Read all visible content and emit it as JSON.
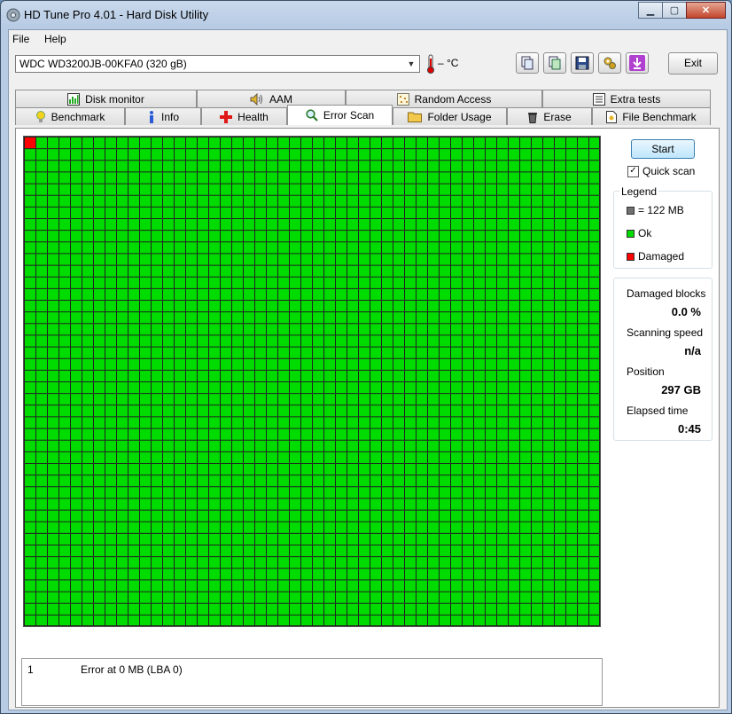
{
  "window": {
    "title": "HD Tune Pro 4.01 - Hard Disk Utility"
  },
  "menu": [
    "File",
    "Help"
  ],
  "toolbar": {
    "drive": "WDC WD3200JB-00KFA0 (320 gB)",
    "temperature": "– °C",
    "exit_label": "Exit"
  },
  "tabs_top": [
    {
      "label": "Disk monitor",
      "icon": "chart-icon"
    },
    {
      "label": "AAM",
      "icon": "speaker-icon"
    },
    {
      "label": "Random Access",
      "icon": "dots-icon"
    },
    {
      "label": "Extra tests",
      "icon": "list-icon"
    }
  ],
  "tabs_bottom": [
    {
      "label": "Benchmark",
      "icon": "bulb-icon"
    },
    {
      "label": "Info",
      "icon": "info-icon"
    },
    {
      "label": "Health",
      "icon": "cross-icon"
    },
    {
      "label": "Error Scan",
      "icon": "magnifier-icon",
      "active": true
    },
    {
      "label": "Folder Usage",
      "icon": "folder-icon"
    },
    {
      "label": "Erase",
      "icon": "trash-icon"
    },
    {
      "label": "File Benchmark",
      "icon": "file-icon"
    }
  ],
  "scan": {
    "start_label": "Start",
    "quick_scan_label": "Quick scan",
    "quick_scan_checked": true
  },
  "legend": {
    "title": "Legend",
    "block_size": "= 122 MB",
    "ok": "Ok",
    "damaged": "Damaged"
  },
  "stats": {
    "damaged_blocks_label": "Damaged blocks",
    "damaged_blocks": "0.0 %",
    "scanning_speed_label": "Scanning speed",
    "scanning_speed": "n/a",
    "position_label": "Position",
    "position": "297 GB",
    "elapsed_label": "Elapsed time",
    "elapsed": "0:45"
  },
  "log": [
    {
      "index": "1",
      "message": "Error at 0 MB (LBA 0)"
    }
  ],
  "colors": {
    "ok": "#00dc00",
    "damaged": "#ff0000",
    "block": "#707070",
    "grid_line": "#222222"
  },
  "grid_state": {
    "columns": 50,
    "rows": 42,
    "damaged_cells": [
      0
    ]
  }
}
